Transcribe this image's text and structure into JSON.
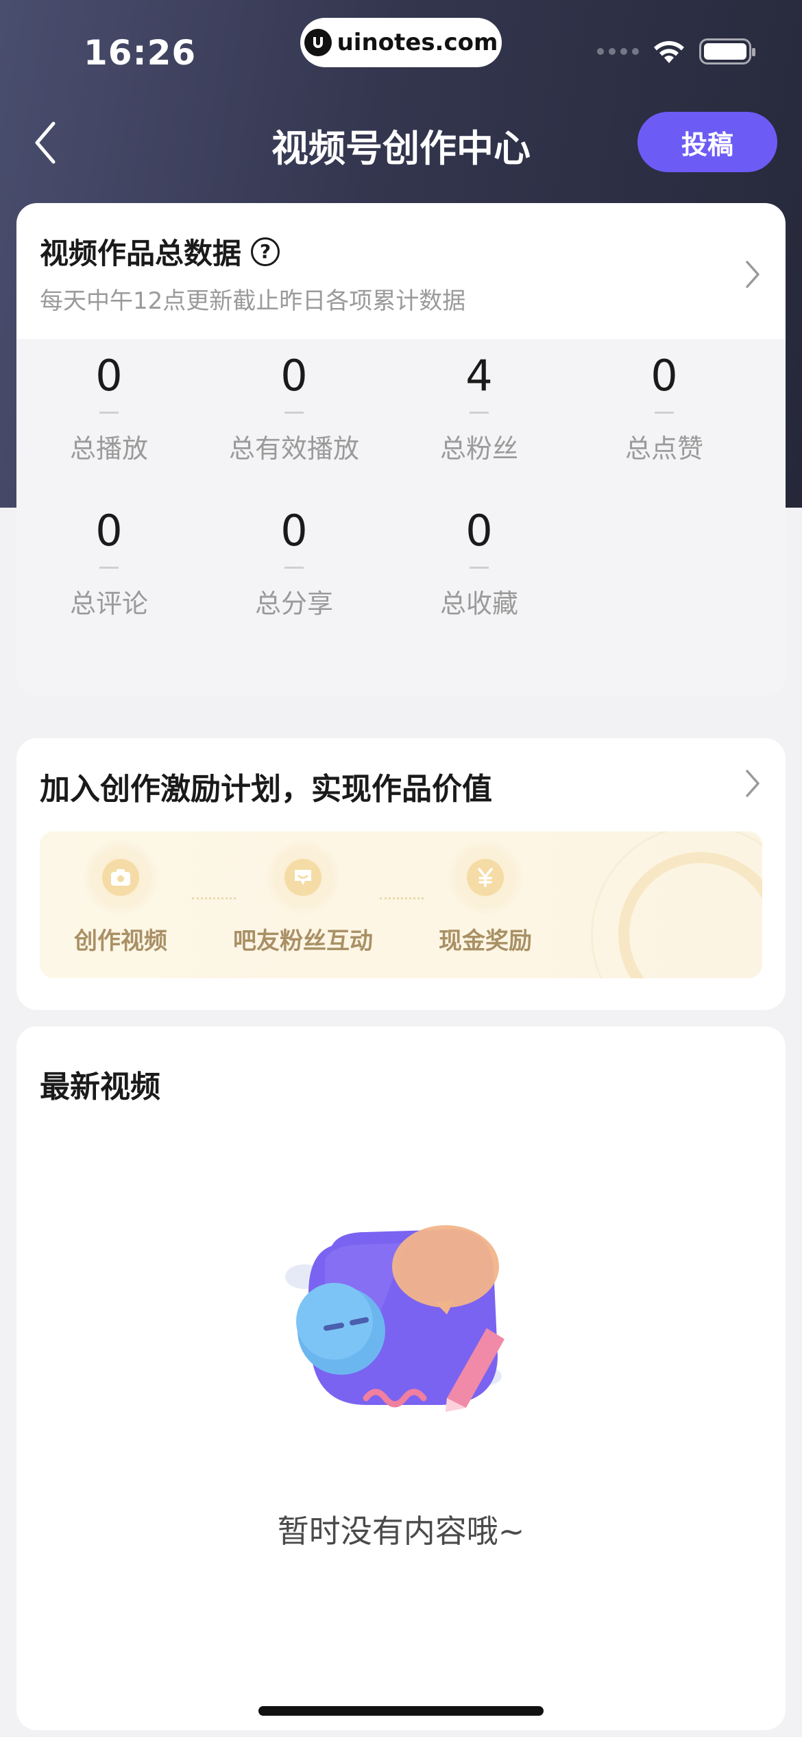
{
  "status_bar": {
    "time": "16:26",
    "url": "uinotes.com"
  },
  "nav": {
    "title": "视频号创作中心",
    "submit_label": "投稿",
    "back_icon": "chevron-left-icon"
  },
  "stats": {
    "title": "视频作品总数据",
    "help_icon": "question-circle-icon",
    "help_glyph": "?",
    "subtitle": "每天中午12点更新截止昨日各项累计数据",
    "items": [
      {
        "value": "0",
        "dash": "—",
        "label": "总播放"
      },
      {
        "value": "0",
        "dash": "—",
        "label": "总有效播放"
      },
      {
        "value": "4",
        "dash": "—",
        "label": "总粉丝"
      },
      {
        "value": "0",
        "dash": "—",
        "label": "总点赞"
      },
      {
        "value": "0",
        "dash": "—",
        "label": "总评论"
      },
      {
        "value": "0",
        "dash": "—",
        "label": "总分享"
      },
      {
        "value": "0",
        "dash": "—",
        "label": "总收藏"
      }
    ]
  },
  "incentive": {
    "title": "加入创作激励计划，实现作品价值",
    "steps": [
      {
        "icon": "camera-icon",
        "label": "创作视频"
      },
      {
        "icon": "chat-icon",
        "label": "吧友粉丝互动"
      },
      {
        "icon": "yuan-icon",
        "label": "现金奖励"
      }
    ],
    "colors": {
      "banner": "#fdf7e7",
      "label": "#a99065"
    }
  },
  "latest": {
    "title": "最新视频",
    "empty_text": "暂时没有内容哦~",
    "empty_icon": "empty-state-illustration"
  },
  "colors": {
    "accent": "#6c5cf5",
    "header_bg": "#34364f",
    "page_bg": "#f2f2f5"
  }
}
